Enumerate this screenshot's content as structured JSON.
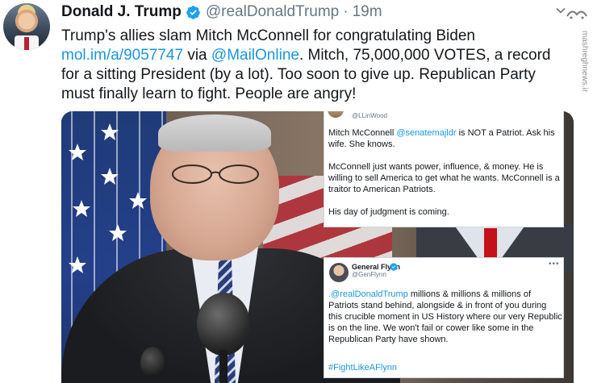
{
  "tweet": {
    "author_name": "Donald J. Trump",
    "author_handle": "@realDonaldTrump",
    "separator": "·",
    "time": "19m",
    "text_part1": "Trump's allies slam Mitch McConnell for congratulating Biden ",
    "link1": "mol.im/a/9057747",
    "text_via": " via ",
    "link2": "@MailOnline",
    "text_part2": ". Mitch, 75,000,000 VOTES, a record for a sitting President (by a lot). Too soon to give up. Republican Party must finally learn to fight. People are angry!"
  },
  "watermark": {
    "text": "mashreghnews.ir"
  },
  "embedded_tweets": [
    {
      "handle": "@LLinWood",
      "line1_pre": "Mitch McConnell ",
      "line1_link": "@senatemajldr",
      "line1_post": " is NOT a Patriot. Ask his wife. She knows.",
      "para2": "McConnell just wants power, influence, & money. He is willing to sell America to get what he wants. McConnell is a traitor to American Patriots.",
      "para3": "His day of judgment is coming."
    },
    {
      "name": "General Flynn",
      "handle": "@GenFlynn",
      "more": "•••",
      "body_link": ".@realDonaldTrump",
      "body_text": " millions & millions & millions of Patriots stand behind, alongside & in front of you during this crucible moment in US History where our very Republic is on the line. We won't fail or cower like some in the Republican Party have shown.",
      "hashtag": "#FightLikeAFlynn"
    }
  ],
  "colors": {
    "link": "#1b95e0",
    "verified": "#1da1f2",
    "secondary_text": "#657786"
  }
}
